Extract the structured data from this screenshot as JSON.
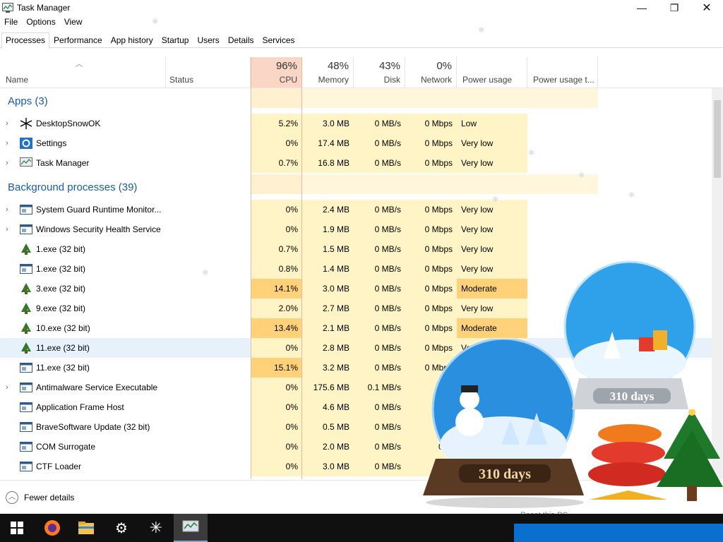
{
  "window": {
    "title": "Task Manager"
  },
  "menu": [
    "File",
    "Options",
    "View"
  ],
  "tabs": [
    "Processes",
    "Performance",
    "App history",
    "Startup",
    "Users",
    "Details",
    "Services"
  ],
  "columns": {
    "name": "Name",
    "status": "Status",
    "cpu": {
      "pct": "96%",
      "label": "CPU"
    },
    "memory": {
      "pct": "48%",
      "label": "Memory"
    },
    "disk": {
      "pct": "43%",
      "label": "Disk"
    },
    "network": {
      "pct": "0%",
      "label": "Network"
    },
    "power": "Power usage",
    "power_trend": "Power usage t..."
  },
  "groups": {
    "apps": "Apps (3)",
    "background": "Background processes (39)"
  },
  "apps": [
    {
      "name": "DesktopSnowOK",
      "icon": "snowflake-icon",
      "expand": true,
      "cpu": "5.2%",
      "memory": "3.0 MB",
      "disk": "0 MB/s",
      "network": "0 Mbps",
      "power": "Low"
    },
    {
      "name": "Settings",
      "icon": "gear-icon",
      "expand": true,
      "cpu": "0%",
      "memory": "17.4 MB",
      "disk": "0 MB/s",
      "network": "0 Mbps",
      "power": "Very low"
    },
    {
      "name": "Task Manager",
      "icon": "task-manager-icon",
      "expand": true,
      "cpu": "0.7%",
      "memory": "16.8 MB",
      "disk": "0 MB/s",
      "network": "0 Mbps",
      "power": "Very low"
    }
  ],
  "background": [
    {
      "name": "System Guard Runtime Monitor...",
      "icon": "window-app-icon",
      "expand": true,
      "cpu": "0%",
      "memory": "2.4 MB",
      "disk": "0 MB/s",
      "network": "0 Mbps",
      "power": "Very low"
    },
    {
      "name": "Windows Security Health Service",
      "icon": "window-app-icon",
      "expand": true,
      "cpu": "0%",
      "memory": "1.9 MB",
      "disk": "0 MB/s",
      "network": "0 Mbps",
      "power": "Very low"
    },
    {
      "name": "1.exe (32 bit)",
      "icon": "xmas-tree-icon",
      "expand": false,
      "cpu": "0.7%",
      "memory": "1.5 MB",
      "disk": "0 MB/s",
      "network": "0 Mbps",
      "power": "Very low"
    },
    {
      "name": "1.exe (32 bit)",
      "icon": "window-app-icon",
      "expand": false,
      "cpu": "0.8%",
      "memory": "1.4 MB",
      "disk": "0 MB/s",
      "network": "0 Mbps",
      "power": "Very low"
    },
    {
      "name": "3.exe (32 bit)",
      "icon": "xmas-tree-icon",
      "expand": false,
      "cpu": "14.1%",
      "memory": "3.0 MB",
      "disk": "0 MB/s",
      "network": "0 Mbps",
      "power": "Moderate"
    },
    {
      "name": "9.exe (32 bit)",
      "icon": "xmas-tree-icon",
      "expand": false,
      "cpu": "2.0%",
      "memory": "2.7 MB",
      "disk": "0 MB/s",
      "network": "0 Mbps",
      "power": "Very low"
    },
    {
      "name": "10.exe (32 bit)",
      "icon": "xmas-tree-icon",
      "expand": false,
      "cpu": "13.4%",
      "memory": "2.1 MB",
      "disk": "0 MB/s",
      "network": "0 Mbps",
      "power": "Moderate"
    },
    {
      "name": "11.exe (32 bit)",
      "icon": "xmas-tree-icon",
      "expand": false,
      "cpu": "0%",
      "memory": "2.8 MB",
      "disk": "0 MB/s",
      "network": "0 Mbps",
      "power": "Ver",
      "selected": true
    },
    {
      "name": "11.exe (32 bit)",
      "icon": "window-app-icon",
      "expand": false,
      "cpu": "15.1%",
      "memory": "3.2 MB",
      "disk": "0 MB/s",
      "network": "0 Mbps",
      "power": ""
    },
    {
      "name": "Antimalware Service Executable",
      "icon": "window-app-icon",
      "expand": true,
      "cpu": "0%",
      "memory": "175.6 MB",
      "disk": "0.1 MB/s",
      "network": "0 M",
      "power": ""
    },
    {
      "name": "Application Frame Host",
      "icon": "window-app-icon",
      "expand": false,
      "cpu": "0%",
      "memory": "4.6 MB",
      "disk": "0 MB/s",
      "network": "0 M",
      "power": ""
    },
    {
      "name": "BraveSoftware Update (32 bit)",
      "icon": "window-app-icon",
      "expand": false,
      "cpu": "0%",
      "memory": "0.5 MB",
      "disk": "0 MB/s",
      "network": "0 M",
      "power": ""
    },
    {
      "name": "COM Surrogate",
      "icon": "window-app-icon",
      "expand": false,
      "cpu": "0%",
      "memory": "2.0 MB",
      "disk": "0 MB/s",
      "network": "0 M",
      "power": ""
    },
    {
      "name": "CTF Loader",
      "icon": "window-app-icon",
      "expand": false,
      "cpu": "0%",
      "memory": "3.0 MB",
      "disk": "0 MB/s",
      "network": "0 M",
      "power": ""
    }
  ],
  "footer": {
    "fewer_details": "Fewer details"
  },
  "taskbar": [
    "windows-start-icon",
    "firefox-icon",
    "file-explorer-icon",
    "settings-gear-icon",
    "desktopsnowok-icon",
    "task-manager-icon"
  ],
  "overlay": {
    "globe_label_1": "310 days",
    "globe_label_2": "310 days",
    "reset_text": "Reset this PC"
  },
  "colors": {
    "cpu_header": "#f9d6c5",
    "heat_light": "#fff4c6",
    "heat_mid": "#ffe8a6",
    "heat_high": "#ffd27a",
    "power_moderate": "#ffd27a",
    "group_blue": "#1a5aa8"
  }
}
